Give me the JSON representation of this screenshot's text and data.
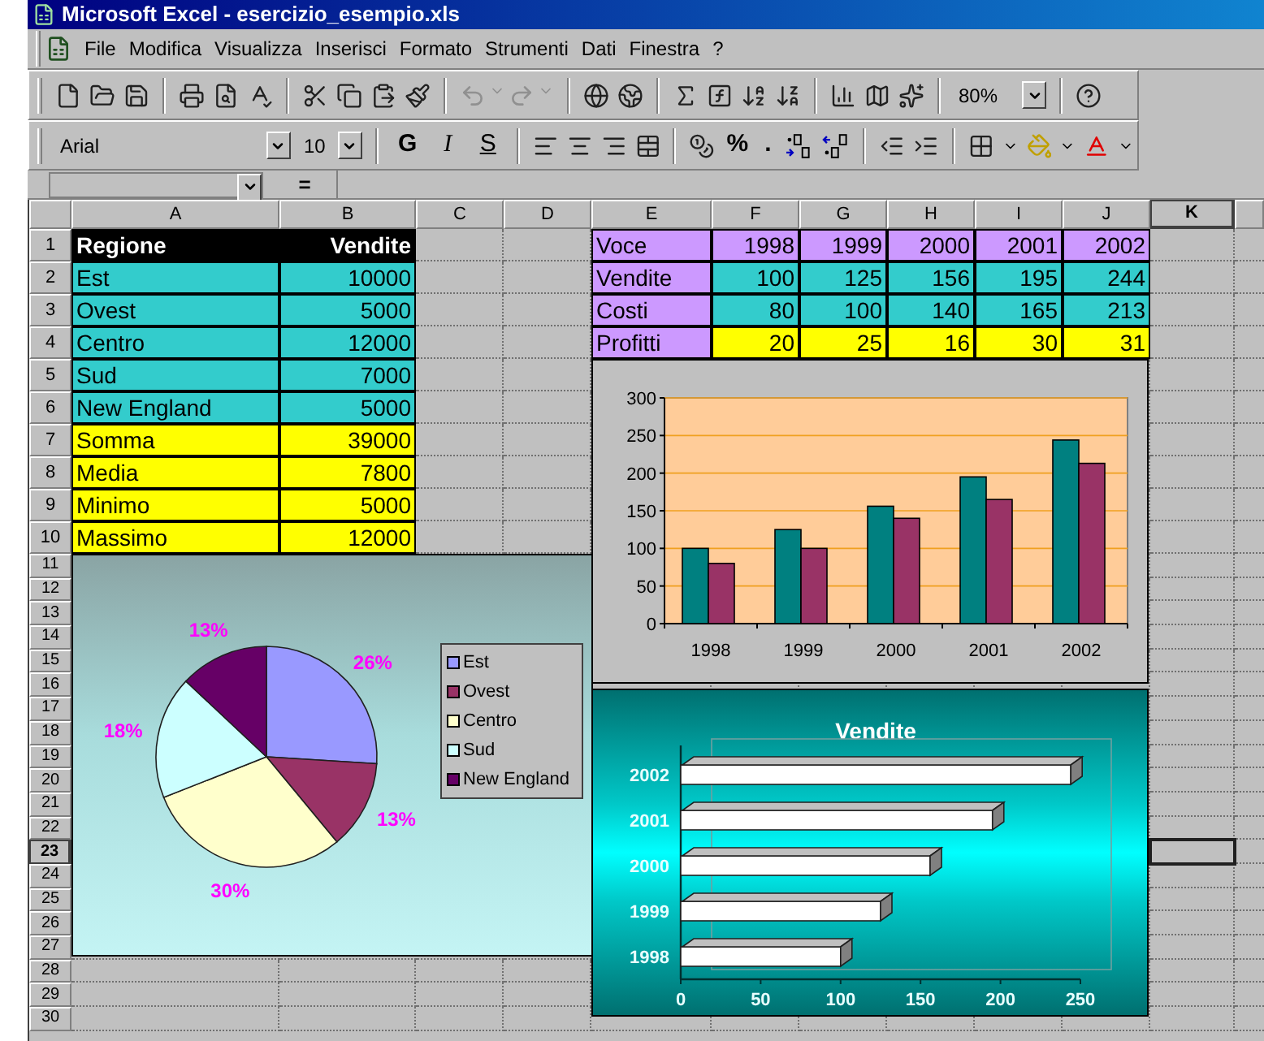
{
  "window": {
    "title": "Microsoft Excel - esercizio_esempio.xls"
  },
  "menu": [
    "File",
    "Modifica",
    "Visualizza",
    "Inserisci",
    "Formato",
    "Strumenti",
    "Dati",
    "Finestra",
    "?"
  ],
  "toolbar": {
    "zoom": "80%"
  },
  "format_toolbar": {
    "font": "Arial",
    "size": "10",
    "style_buttons": [
      {
        "label": "G",
        "kind": "bold"
      },
      {
        "label": "I",
        "kind": "italic"
      },
      {
        "label": "S",
        "kind": "underline"
      }
    ],
    "percent": "%",
    "thousands": "."
  },
  "formula_bar": {
    "equals": "="
  },
  "sheet": {
    "columns": [
      {
        "label": "A",
        "selected": false
      },
      {
        "label": "B",
        "selected": false
      },
      {
        "label": "C",
        "selected": false
      },
      {
        "label": "D",
        "selected": false
      },
      {
        "label": "E",
        "selected": false
      },
      {
        "label": "F",
        "selected": false
      },
      {
        "label": "G",
        "selected": false
      },
      {
        "label": "H",
        "selected": false
      },
      {
        "label": "I",
        "selected": false
      },
      {
        "label": "J",
        "selected": false
      },
      {
        "label": "K",
        "selected": true
      }
    ],
    "rows": [
      {
        "label": "1",
        "selected": false
      },
      {
        "label": "2",
        "selected": false
      },
      {
        "label": "3",
        "selected": false
      },
      {
        "label": "4",
        "selected": false
      },
      {
        "label": "5",
        "selected": false
      },
      {
        "label": "6",
        "selected": false
      },
      {
        "label": "7",
        "selected": false
      },
      {
        "label": "8",
        "selected": false
      },
      {
        "label": "9",
        "selected": false
      },
      {
        "label": "10",
        "selected": false
      },
      {
        "label": "11",
        "selected": false
      },
      {
        "label": "12",
        "selected": false
      },
      {
        "label": "13",
        "selected": false
      },
      {
        "label": "14",
        "selected": false
      },
      {
        "label": "15",
        "selected": false
      },
      {
        "label": "16",
        "selected": false
      },
      {
        "label": "17",
        "selected": false
      },
      {
        "label": "18",
        "selected": false
      },
      {
        "label": "19",
        "selected": false
      },
      {
        "label": "20",
        "selected": false
      },
      {
        "label": "21",
        "selected": false
      },
      {
        "label": "22",
        "selected": false
      },
      {
        "label": "23",
        "selected": true
      },
      {
        "label": "24",
        "selected": false
      },
      {
        "label": "25",
        "selected": false
      },
      {
        "label": "26",
        "selected": false
      },
      {
        "label": "27",
        "selected": false
      },
      {
        "label": "28",
        "selected": false
      },
      {
        "label": "29",
        "selected": false
      },
      {
        "label": "30",
        "selected": false
      }
    ]
  },
  "regions_table": {
    "rows": [
      {
        "kind": "header",
        "label": "Regione",
        "value": "Vendite"
      },
      {
        "kind": "data",
        "label": "Est",
        "value": "10000"
      },
      {
        "kind": "data",
        "label": "Ovest",
        "value": "5000"
      },
      {
        "kind": "data",
        "label": "Centro",
        "value": "12000"
      },
      {
        "kind": "data",
        "label": "Sud",
        "value": "7000"
      },
      {
        "kind": "data",
        "label": "New England",
        "value": "5000"
      },
      {
        "kind": "summary",
        "label": "Somma",
        "value": "39000"
      },
      {
        "kind": "summary",
        "label": "Media",
        "value": "7800"
      },
      {
        "kind": "summary",
        "label": "Minimo",
        "value": "5000"
      },
      {
        "kind": "summary",
        "label": "Massimo",
        "value": "12000"
      }
    ]
  },
  "yearly_table": {
    "rows": [
      {
        "kind": "header",
        "cells": [
          "Voce",
          "1998",
          "1999",
          "2000",
          "2001",
          "2002"
        ]
      },
      {
        "kind": "data",
        "cells": [
          "Vendite",
          "100",
          "125",
          "156",
          "195",
          "244"
        ]
      },
      {
        "kind": "data",
        "cells": [
          "Costi",
          "80",
          "100",
          "140",
          "165",
          "213"
        ]
      },
      {
        "kind": "result",
        "cells": [
          "Profitti",
          "20",
          "25",
          "16",
          "30",
          "31"
        ]
      }
    ]
  },
  "pie_chart": {
    "chart_data": {
      "type": "pie",
      "categories": [
        "Est",
        "Ovest",
        "Centro",
        "Sud",
        "New England"
      ],
      "values": [
        26,
        13,
        30,
        18,
        13
      ],
      "value_labels": [
        "26%",
        "13%",
        "30%",
        "18%",
        "13%"
      ],
      "colors": [
        "#9999ff",
        "#993366",
        "#ffffcc",
        "#ccffff",
        "#660066"
      ],
      "legend": "right"
    }
  },
  "column_chart": {
    "chart_data": {
      "type": "bar",
      "categories": [
        "1998",
        "1999",
        "2000",
        "2001",
        "2002"
      ],
      "series": [
        {
          "color": "#008080",
          "values": [
            100,
            125,
            156,
            195,
            244
          ]
        },
        {
          "color": "#993366",
          "values": [
            80,
            100,
            140,
            165,
            213
          ]
        }
      ],
      "ylim": [
        0,
        300
      ],
      "yticks": [
        0,
        50,
        100,
        150,
        200,
        250,
        300
      ],
      "grid": true
    }
  },
  "bar_chart": {
    "chart_data": {
      "type": "bar",
      "orientation": "horizontal",
      "title": "Vendite",
      "categories": [
        "2002",
        "2001",
        "2000",
        "1999",
        "1998"
      ],
      "values": [
        244,
        195,
        156,
        125,
        100
      ],
      "xlim": [
        0,
        250
      ],
      "xticks": [
        0,
        50,
        100,
        150,
        200,
        250
      ]
    }
  }
}
